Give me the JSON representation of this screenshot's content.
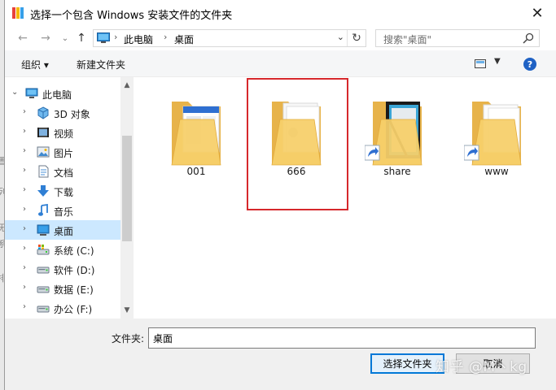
{
  "window": {
    "title": "选择一个包含 Windows 安装文件的文件夹"
  },
  "nav": {
    "breadcrumb": [
      "此电脑",
      "桌面"
    ],
    "search_placeholder": "搜索\"桌面\""
  },
  "toolbar": {
    "organize": "组织 ▾",
    "new_folder": "新建文件夹",
    "help": "?"
  },
  "tree": [
    {
      "label": "此电脑",
      "icon": "computer-icon",
      "level": 0,
      "expanded": true
    },
    {
      "label": "3D 对象",
      "icon": "3d-objects-icon",
      "level": 1
    },
    {
      "label": "视频",
      "icon": "video-icon",
      "level": 1
    },
    {
      "label": "图片",
      "icon": "pictures-icon",
      "level": 1
    },
    {
      "label": "文档",
      "icon": "documents-icon",
      "level": 1
    },
    {
      "label": "下载",
      "icon": "download-icon",
      "level": 1
    },
    {
      "label": "音乐",
      "icon": "music-icon",
      "level": 1
    },
    {
      "label": "桌面",
      "icon": "desktop-icon",
      "level": 1,
      "selected": true
    },
    {
      "label": "系统 (C:)",
      "icon": "system-drive-icon",
      "level": 1
    },
    {
      "label": "软件 (D:)",
      "icon": "drive-icon",
      "level": 1
    },
    {
      "label": "数据 (E:)",
      "icon": "drive-icon",
      "level": 1
    },
    {
      "label": "办公 (F:)",
      "icon": "drive-icon",
      "level": 1
    }
  ],
  "items": [
    {
      "name": "001",
      "icon": "folder-icon",
      "shortcut": false
    },
    {
      "name": "666",
      "icon": "folder-icon",
      "shortcut": false,
      "highlighted": true
    },
    {
      "name": "share",
      "icon": "folder-shortcut-icon",
      "shortcut": true
    },
    {
      "name": "www",
      "icon": "folder-shortcut-icon",
      "shortcut": true
    }
  ],
  "footer": {
    "folder_label": "文件夹:",
    "folder_value": "桌面",
    "select_button": "选择文件夹",
    "cancel_button": "取消"
  },
  "watermark": "知乎 @M丶kg",
  "colors": {
    "folder": "#f2c75c",
    "highlight_box": "#d6282c",
    "selected": "#cce8ff",
    "accent": "#0078d7"
  }
}
